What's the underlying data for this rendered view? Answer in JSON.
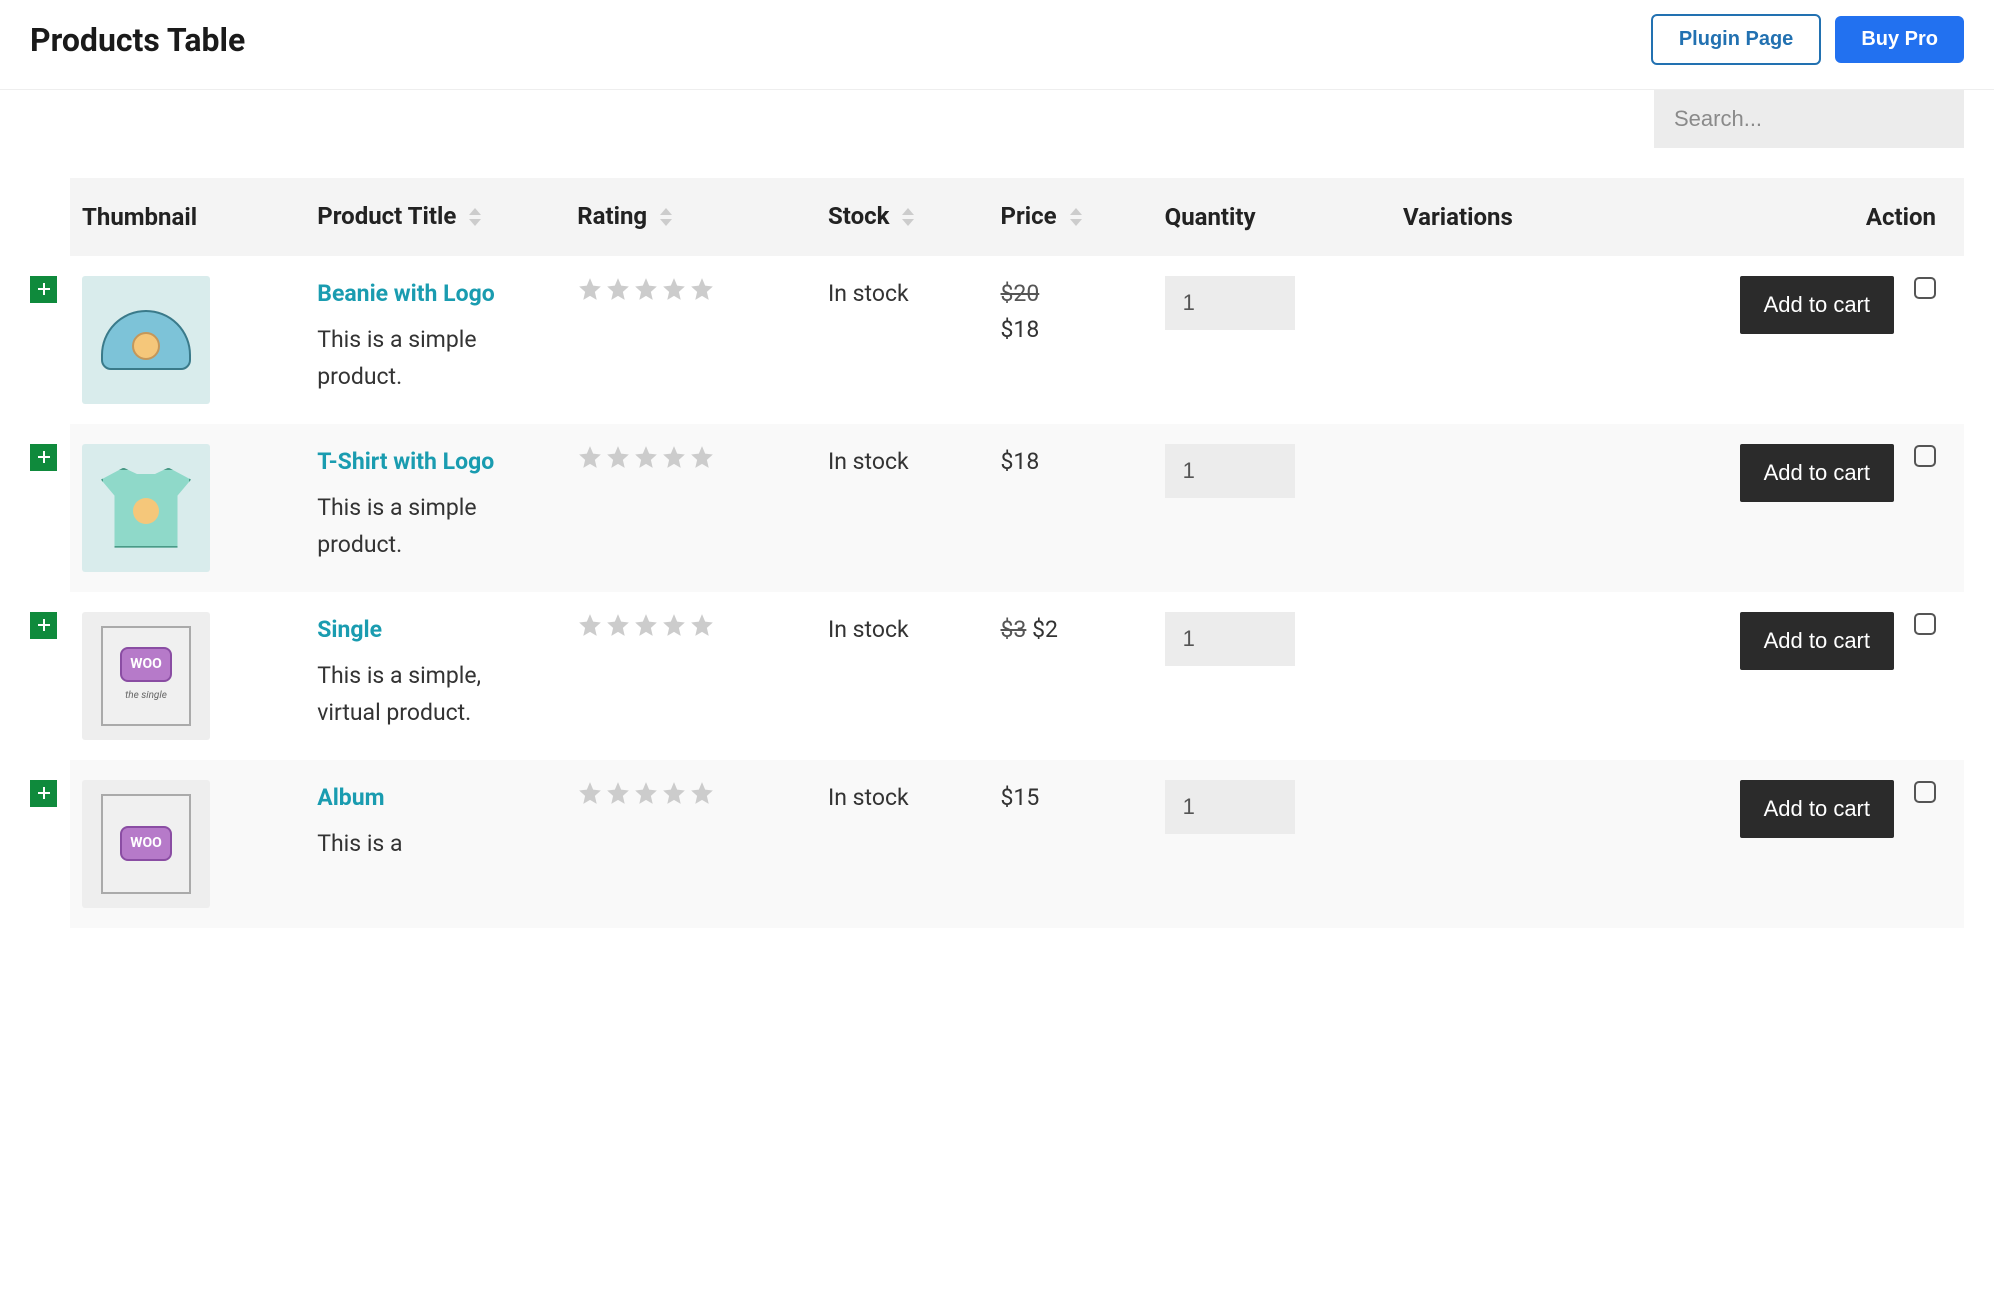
{
  "header": {
    "title": "Products Table",
    "plugin_page": "Plugin Page",
    "buy_pro": "Buy Pro"
  },
  "search": {
    "placeholder": "Search..."
  },
  "columns": {
    "thumbnail": "Thumbnail",
    "title": "Product Title",
    "rating": "Rating",
    "stock": "Stock",
    "price": "Price",
    "quantity": "Quantity",
    "variations": "Variations",
    "action": "Action"
  },
  "add_to_cart": "Add to cart",
  "products": [
    {
      "title": "Beanie with Logo",
      "desc": "This is a simple product.",
      "stock": "In stock",
      "price_original": "$20",
      "price": "$18",
      "qty": "1",
      "thumb_type": "beanie"
    },
    {
      "title": "T-Shirt with Logo",
      "desc": "This is a simple product.",
      "stock": "In stock",
      "price_original": "",
      "price": "$18",
      "qty": "1",
      "thumb_type": "tshirt"
    },
    {
      "title": "Single",
      "desc": "This is a simple, virtual product.",
      "stock": "In stock",
      "price_original": "$3",
      "price": "$2",
      "qty": "1",
      "thumb_type": "woo-single"
    },
    {
      "title": "Album",
      "desc": "This is a",
      "stock": "In stock",
      "price_original": "",
      "price": "$15",
      "qty": "1",
      "thumb_type": "woo-album"
    }
  ]
}
